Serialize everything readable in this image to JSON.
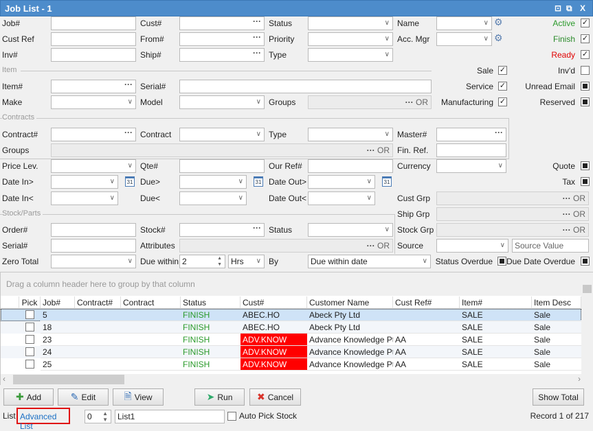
{
  "window": {
    "title": "Job List - 1",
    "pin_icon": "pin-icon",
    "restore_icon": "restore-icon",
    "close_label": "X"
  },
  "filters": {
    "job_no": "Job#",
    "cust_no": "Cust#",
    "status": "Status",
    "name": "Name",
    "active": "Active",
    "cust_ref": "Cust Ref",
    "from_no": "From#",
    "priority": "Priority",
    "acc_mgr": "Acc. Mgr",
    "finish": "Finish",
    "inv_no": "Inv#",
    "ship_no": "Ship#",
    "type": "Type",
    "ready": "Ready",
    "item_section": "Item",
    "sale": "Sale",
    "invd": "Inv'd",
    "item_no": "Item#",
    "serial_no": "Serial#",
    "service": "Service",
    "unread_email": "Unread Email",
    "make": "Make",
    "model": "Model",
    "groups": "Groups",
    "manufacturing": "Manufacturing",
    "reserved": "Reserved",
    "contracts_section": "Contracts",
    "contract_no": "Contract#",
    "contract": "Contract",
    "contract_type": "Type",
    "master_no": "Master#",
    "contract_groups": "Groups",
    "fin_ref": "Fin. Ref.",
    "price_lev": "Price Lev.",
    "qte_no": "Qte#",
    "our_ref": "Our Ref#",
    "currency": "Currency",
    "quote": "Quote",
    "date_in_gt": "Date In>",
    "due_gt": "Due>",
    "date_out_gt": "Date Out>",
    "tax": "Tax",
    "date_in_lt": "Date In<",
    "due_lt": "Due<",
    "date_out_lt": "Date Out<",
    "cust_grp": "Cust Grp",
    "stock_section": "Stock/Parts",
    "ship_grp": "Ship Grp",
    "order_no": "Order#",
    "stock_no": "Stock#",
    "stock_status": "Status",
    "stock_grp": "Stock Grp",
    "stock_serial": "Serial#",
    "attributes": "Attributes",
    "source": "Source",
    "source_value_placeholder": "Source Value",
    "zero_total": "Zero Total",
    "due_within": "Due within",
    "due_within_value": "2",
    "due_unit": "Hrs",
    "by": "By",
    "by_value": "Due within date",
    "status_overdue": "Status Overdue",
    "due_date_overdue": "Due Date Overdue",
    "or": "OR",
    "dots": "···",
    "colors": {
      "active": "#2a9a2a",
      "finish": "#2a8a2a",
      "ready": "#e00000"
    }
  },
  "grid": {
    "group_hint": "Drag a column header here to group by that column",
    "columns": [
      "Pick",
      "Job#",
      "Contract#",
      "Contract",
      "Status",
      "Cust#",
      "Customer Name",
      "Cust Ref#",
      "Item#",
      "Item Desc"
    ],
    "rows": [
      {
        "job": "5",
        "status": "FINISH",
        "cust": "ABEC.HO",
        "name": "Abeck Pty Ltd",
        "ref": "",
        "item": "SALE",
        "desc": "Sale",
        "flag": false,
        "selected": true
      },
      {
        "job": "18",
        "status": "FINISH",
        "cust": "ABEC.HO",
        "name": "Abeck Pty Ltd",
        "ref": "",
        "item": "SALE",
        "desc": "Sale",
        "flag": false
      },
      {
        "job": "23",
        "status": "FINISH",
        "cust": "ADV.KNOW",
        "name": "Advance Knowledge Pty",
        "ref": "AA",
        "item": "SALE",
        "desc": "Sale",
        "flag": true
      },
      {
        "job": "24",
        "status": "FINISH",
        "cust": "ADV.KNOW",
        "name": "Advance Knowledge Pty",
        "ref": "AA",
        "item": "SALE",
        "desc": "Sale",
        "flag": true
      },
      {
        "job": "25",
        "status": "FINISH",
        "cust": "ADV.KNOW",
        "name": "Advance Knowledge Pty",
        "ref": "AA",
        "item": "SALE",
        "desc": "Sale",
        "flag": true
      }
    ],
    "status_color": "#2a9a2a",
    "flag_color": "#ff0000"
  },
  "buttons": {
    "add": "Add",
    "edit": "Edit",
    "view": "View",
    "run": "Run",
    "cancel": "Cancel",
    "show_total": "Show Total"
  },
  "footer": {
    "list": "List",
    "advanced_list": "Advanced List",
    "list_no": "0",
    "list_name": "List1",
    "auto_pick": "Auto Pick Stock",
    "record": "Record 1 of 217"
  }
}
